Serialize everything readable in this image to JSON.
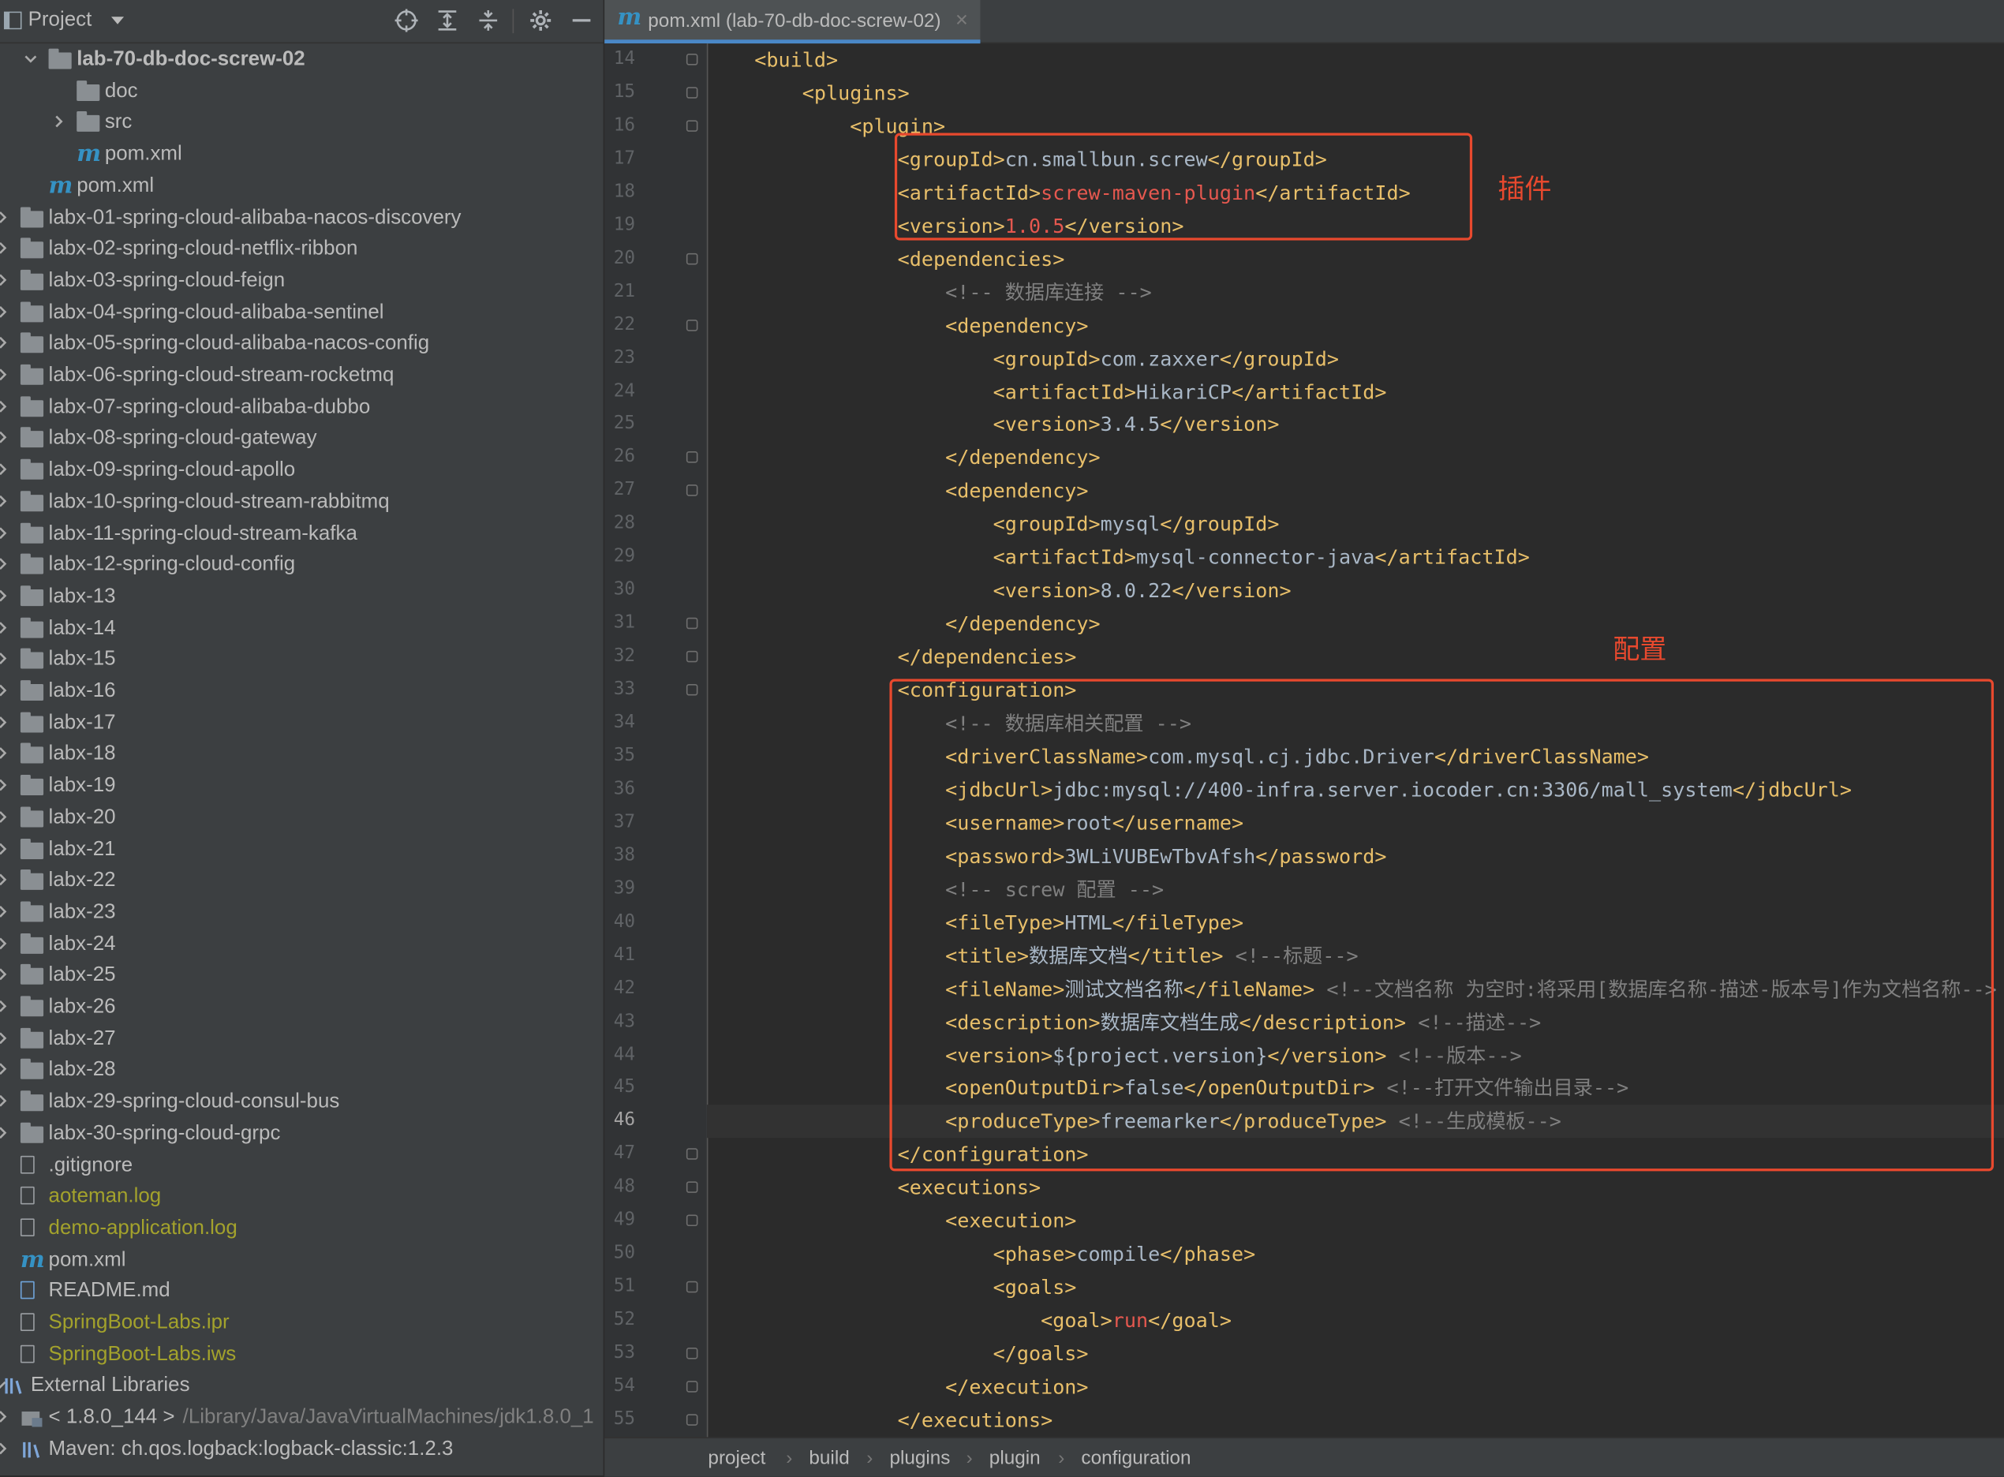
{
  "project_panel": {
    "title": "Project",
    "tree": [
      {
        "label": "lab-70-db-doc-screw-02",
        "kind": "folder",
        "indent": 1,
        "arrow": "down",
        "bold": true
      },
      {
        "label": "doc",
        "kind": "folder",
        "indent": 2,
        "arrow": ""
      },
      {
        "label": "src",
        "kind": "folder",
        "indent": 2,
        "arrow": "right"
      },
      {
        "label": "pom.xml",
        "kind": "maven",
        "indent": 2,
        "arrow": ""
      },
      {
        "label": "pom.xml",
        "kind": "maven",
        "indent": 1,
        "arrow": ""
      },
      {
        "label": "labx-01-spring-cloud-alibaba-nacos-discovery",
        "kind": "folder",
        "indent": 0,
        "arrow": "right"
      },
      {
        "label": "labx-02-spring-cloud-netflix-ribbon",
        "kind": "folder",
        "indent": 0,
        "arrow": "right"
      },
      {
        "label": "labx-03-spring-cloud-feign",
        "kind": "folder",
        "indent": 0,
        "arrow": "right"
      },
      {
        "label": "labx-04-spring-cloud-alibaba-sentinel",
        "kind": "folder",
        "indent": 0,
        "arrow": "right"
      },
      {
        "label": "labx-05-spring-cloud-alibaba-nacos-config",
        "kind": "folder",
        "indent": 0,
        "arrow": "right"
      },
      {
        "label": "labx-06-spring-cloud-stream-rocketmq",
        "kind": "folder",
        "indent": 0,
        "arrow": "right"
      },
      {
        "label": "labx-07-spring-cloud-alibaba-dubbo",
        "kind": "folder",
        "indent": 0,
        "arrow": "right"
      },
      {
        "label": "labx-08-spring-cloud-gateway",
        "kind": "folder",
        "indent": 0,
        "arrow": "right"
      },
      {
        "label": "labx-09-spring-cloud-apollo",
        "kind": "folder",
        "indent": 0,
        "arrow": "right"
      },
      {
        "label": "labx-10-spring-cloud-stream-rabbitmq",
        "kind": "folder",
        "indent": 0,
        "arrow": "right"
      },
      {
        "label": "labx-11-spring-cloud-stream-kafka",
        "kind": "folder",
        "indent": 0,
        "arrow": "right"
      },
      {
        "label": "labx-12-spring-cloud-config",
        "kind": "folder",
        "indent": 0,
        "arrow": "right"
      },
      {
        "label": "labx-13",
        "kind": "folder",
        "indent": 0,
        "arrow": "right"
      },
      {
        "label": "labx-14",
        "kind": "folder",
        "indent": 0,
        "arrow": "right"
      },
      {
        "label": "labx-15",
        "kind": "folder",
        "indent": 0,
        "arrow": "right"
      },
      {
        "label": "labx-16",
        "kind": "folder",
        "indent": 0,
        "arrow": "right"
      },
      {
        "label": "labx-17",
        "kind": "folder",
        "indent": 0,
        "arrow": "right"
      },
      {
        "label": "labx-18",
        "kind": "folder",
        "indent": 0,
        "arrow": "right"
      },
      {
        "label": "labx-19",
        "kind": "folder",
        "indent": 0,
        "arrow": "right"
      },
      {
        "label": "labx-20",
        "kind": "folder",
        "indent": 0,
        "arrow": "right"
      },
      {
        "label": "labx-21",
        "kind": "folder",
        "indent": 0,
        "arrow": "right"
      },
      {
        "label": "labx-22",
        "kind": "folder",
        "indent": 0,
        "arrow": "right"
      },
      {
        "label": "labx-23",
        "kind": "folder",
        "indent": 0,
        "arrow": "right"
      },
      {
        "label": "labx-24",
        "kind": "folder",
        "indent": 0,
        "arrow": "right"
      },
      {
        "label": "labx-25",
        "kind": "folder",
        "indent": 0,
        "arrow": "right"
      },
      {
        "label": "labx-26",
        "kind": "folder",
        "indent": 0,
        "arrow": "right"
      },
      {
        "label": "labx-27",
        "kind": "folder",
        "indent": 0,
        "arrow": "right"
      },
      {
        "label": "labx-28",
        "kind": "folder",
        "indent": 0,
        "arrow": "right"
      },
      {
        "label": "labx-29-spring-cloud-consul-bus",
        "kind": "folder",
        "indent": 0,
        "arrow": "right"
      },
      {
        "label": "labx-30-spring-cloud-grpc",
        "kind": "folder",
        "indent": 0,
        "arrow": "right"
      },
      {
        "label": ".gitignore",
        "kind": "file",
        "indent": 0,
        "arrow": ""
      },
      {
        "label": "aoteman.log",
        "kind": "file",
        "indent": 0,
        "arrow": "",
        "yellow": true
      },
      {
        "label": "demo-application.log",
        "kind": "file",
        "indent": 0,
        "arrow": "",
        "yellow": true
      },
      {
        "label": "pom.xml",
        "kind": "maven",
        "indent": 0,
        "arrow": ""
      },
      {
        "label": "README.md",
        "kind": "md",
        "indent": 0,
        "arrow": ""
      },
      {
        "label": "SpringBoot-Labs.ipr",
        "kind": "file",
        "indent": 0,
        "arrow": "",
        "yellow": true
      },
      {
        "label": "SpringBoot-Labs.iws",
        "kind": "file",
        "indent": 0,
        "arrow": "",
        "yellow": true
      },
      {
        "label": "External Libraries",
        "kind": "lib",
        "indent": -1,
        "arrow": "down"
      },
      {
        "label": "< 1.8.0_144 >",
        "path": "/Library/Java/JavaVirtualMachines/jdk1.8.0_1",
        "kind": "jdk",
        "indent": 0,
        "arrow": "right"
      },
      {
        "label": "Maven: ch.qos.logback:logback-classic:1.2.3",
        "kind": "lib",
        "indent": 0,
        "arrow": "right"
      }
    ]
  },
  "editor": {
    "tab_title": "pom.xml (lab-70-db-doc-screw-02)",
    "current_line": 46,
    "lines": [
      {
        "n": 14,
        "fold": true,
        "parts": [
          [
            "i",
            "    "
          ],
          [
            "t",
            "<build>"
          ]
        ]
      },
      {
        "n": 15,
        "fold": true,
        "parts": [
          [
            "i",
            "        "
          ],
          [
            "t",
            "<plugins>"
          ]
        ]
      },
      {
        "n": 16,
        "fold": true,
        "parts": [
          [
            "i",
            "            "
          ],
          [
            "t",
            "<plugin>"
          ]
        ]
      },
      {
        "n": 17,
        "parts": [
          [
            "i",
            "                "
          ],
          [
            "t",
            "<groupId>"
          ],
          [
            "x",
            "cn.smallbun.screw"
          ],
          [
            "t",
            "</groupId>"
          ]
        ]
      },
      {
        "n": 18,
        "parts": [
          [
            "i",
            "                "
          ],
          [
            "t",
            "<artifactId>"
          ],
          [
            "r",
            "screw-maven-plugin"
          ],
          [
            "t",
            "</artifactId>"
          ]
        ]
      },
      {
        "n": 19,
        "parts": [
          [
            "i",
            "                "
          ],
          [
            "t",
            "<version>"
          ],
          [
            "r",
            "1.0.5"
          ],
          [
            "t",
            "</version>"
          ]
        ]
      },
      {
        "n": 20,
        "fold": true,
        "parts": [
          [
            "i",
            "                "
          ],
          [
            "t",
            "<dependencies>"
          ]
        ]
      },
      {
        "n": 21,
        "parts": [
          [
            "i",
            "                    "
          ],
          [
            "c",
            "<!-- 数据库连接 -->"
          ]
        ]
      },
      {
        "n": 22,
        "fold": true,
        "parts": [
          [
            "i",
            "                    "
          ],
          [
            "t",
            "<dependency>"
          ]
        ]
      },
      {
        "n": 23,
        "parts": [
          [
            "i",
            "                        "
          ],
          [
            "t",
            "<groupId>"
          ],
          [
            "x",
            "com.zaxxer"
          ],
          [
            "t",
            "</groupId>"
          ]
        ]
      },
      {
        "n": 24,
        "parts": [
          [
            "i",
            "                        "
          ],
          [
            "t",
            "<artifactId>"
          ],
          [
            "x",
            "HikariCP"
          ],
          [
            "t",
            "</artifactId>"
          ]
        ]
      },
      {
        "n": 25,
        "parts": [
          [
            "i",
            "                        "
          ],
          [
            "t",
            "<version>"
          ],
          [
            "x",
            "3.4.5"
          ],
          [
            "t",
            "</version>"
          ]
        ]
      },
      {
        "n": 26,
        "fold": true,
        "parts": [
          [
            "i",
            "                    "
          ],
          [
            "t",
            "</dependency>"
          ]
        ]
      },
      {
        "n": 27,
        "fold": true,
        "parts": [
          [
            "i",
            "                    "
          ],
          [
            "t",
            "<dependency>"
          ]
        ]
      },
      {
        "n": 28,
        "parts": [
          [
            "i",
            "                        "
          ],
          [
            "t",
            "<groupId>"
          ],
          [
            "x",
            "mysql"
          ],
          [
            "t",
            "</groupId>"
          ]
        ]
      },
      {
        "n": 29,
        "parts": [
          [
            "i",
            "                        "
          ],
          [
            "t",
            "<artifactId>"
          ],
          [
            "x",
            "mysql-connector-java"
          ],
          [
            "t",
            "</artifactId>"
          ]
        ]
      },
      {
        "n": 30,
        "parts": [
          [
            "i",
            "                        "
          ],
          [
            "t",
            "<version>"
          ],
          [
            "x",
            "8.0.22"
          ],
          [
            "t",
            "</version>"
          ]
        ]
      },
      {
        "n": 31,
        "fold": true,
        "parts": [
          [
            "i",
            "                    "
          ],
          [
            "t",
            "</dependency>"
          ]
        ]
      },
      {
        "n": 32,
        "fold": true,
        "parts": [
          [
            "i",
            "                "
          ],
          [
            "t",
            "</dependencies>"
          ]
        ]
      },
      {
        "n": 33,
        "fold": true,
        "parts": [
          [
            "i",
            "                "
          ],
          [
            "t",
            "<configuration>"
          ]
        ]
      },
      {
        "n": 34,
        "parts": [
          [
            "i",
            "                    "
          ],
          [
            "c",
            "<!-- 数据库相关配置 -->"
          ]
        ]
      },
      {
        "n": 35,
        "parts": [
          [
            "i",
            "                    "
          ],
          [
            "t",
            "<driverClassName>"
          ],
          [
            "x",
            "com.mysql.cj.jdbc.Driver"
          ],
          [
            "t",
            "</driverClassName>"
          ]
        ]
      },
      {
        "n": 36,
        "parts": [
          [
            "i",
            "                    "
          ],
          [
            "t",
            "<jdbcUrl>"
          ],
          [
            "x",
            "jdbc:mysql://400-infra.server.iocoder.cn:3306/mall_system"
          ],
          [
            "t",
            "</jdbcUrl>"
          ]
        ]
      },
      {
        "n": 37,
        "parts": [
          [
            "i",
            "                    "
          ],
          [
            "t",
            "<username>"
          ],
          [
            "x",
            "root"
          ],
          [
            "t",
            "</username>"
          ]
        ]
      },
      {
        "n": 38,
        "parts": [
          [
            "i",
            "                    "
          ],
          [
            "t",
            "<password>"
          ],
          [
            "x",
            "3WLiVUBEwTbvAfsh"
          ],
          [
            "t",
            "</password>"
          ]
        ]
      },
      {
        "n": 39,
        "parts": [
          [
            "i",
            "                    "
          ],
          [
            "c",
            "<!-- screw 配置 -->"
          ]
        ]
      },
      {
        "n": 40,
        "parts": [
          [
            "i",
            "                    "
          ],
          [
            "t",
            "<fileType>"
          ],
          [
            "x",
            "HTML"
          ],
          [
            "t",
            "</fileType>"
          ]
        ]
      },
      {
        "n": 41,
        "parts": [
          [
            "i",
            "                    "
          ],
          [
            "t",
            "<title>"
          ],
          [
            "x",
            "数据库文档"
          ],
          [
            "t",
            "</title>"
          ],
          [
            "x",
            " "
          ],
          [
            "c",
            "<!--标题-->"
          ]
        ]
      },
      {
        "n": 42,
        "parts": [
          [
            "i",
            "                    "
          ],
          [
            "t",
            "<fileName>"
          ],
          [
            "x",
            "测试文档名称"
          ],
          [
            "t",
            "</fileName>"
          ],
          [
            "x",
            " "
          ],
          [
            "c",
            "<!--文档名称 为空时:将采用[数据库名称-描述-版本号]作为文档名称-->"
          ]
        ]
      },
      {
        "n": 43,
        "parts": [
          [
            "i",
            "                    "
          ],
          [
            "t",
            "<description>"
          ],
          [
            "x",
            "数据库文档生成"
          ],
          [
            "t",
            "</description>"
          ],
          [
            "x",
            " "
          ],
          [
            "c",
            "<!--描述-->"
          ]
        ]
      },
      {
        "n": 44,
        "parts": [
          [
            "i",
            "                    "
          ],
          [
            "t",
            "<version>"
          ],
          [
            "x",
            "${project.version}"
          ],
          [
            "t",
            "</version>"
          ],
          [
            "x",
            " "
          ],
          [
            "c",
            "<!--版本-->"
          ]
        ]
      },
      {
        "n": 45,
        "parts": [
          [
            "i",
            "                    "
          ],
          [
            "t",
            "<openOutputDir>"
          ],
          [
            "x",
            "false"
          ],
          [
            "t",
            "</openOutputDir>"
          ],
          [
            "x",
            " "
          ],
          [
            "c",
            "<!--打开文件输出目录-->"
          ]
        ]
      },
      {
        "n": 46,
        "parts": [
          [
            "i",
            "                    "
          ],
          [
            "t",
            "<produceType>"
          ],
          [
            "x",
            "freemarker"
          ],
          [
            "t",
            "</produceType>"
          ],
          [
            "x",
            " "
          ],
          [
            "c",
            "<!--生成模板-->"
          ]
        ]
      },
      {
        "n": 47,
        "fold": true,
        "parts": [
          [
            "i",
            "                "
          ],
          [
            "t",
            "</configuration>"
          ]
        ]
      },
      {
        "n": 48,
        "fold": true,
        "parts": [
          [
            "i",
            "                "
          ],
          [
            "t",
            "<executions>"
          ]
        ]
      },
      {
        "n": 49,
        "fold": true,
        "parts": [
          [
            "i",
            "                    "
          ],
          [
            "t",
            "<execution>"
          ]
        ]
      },
      {
        "n": 50,
        "parts": [
          [
            "i",
            "                        "
          ],
          [
            "t",
            "<phase>"
          ],
          [
            "x",
            "compile"
          ],
          [
            "t",
            "</phase>"
          ]
        ]
      },
      {
        "n": 51,
        "fold": true,
        "parts": [
          [
            "i",
            "                        "
          ],
          [
            "t",
            "<goals>"
          ]
        ]
      },
      {
        "n": 52,
        "parts": [
          [
            "i",
            "                            "
          ],
          [
            "t",
            "<goal>"
          ],
          [
            "r",
            "run"
          ],
          [
            "t",
            "</goal>"
          ]
        ]
      },
      {
        "n": 53,
        "fold": true,
        "parts": [
          [
            "i",
            "                        "
          ],
          [
            "t",
            "</goals>"
          ]
        ]
      },
      {
        "n": 54,
        "fold": true,
        "parts": [
          [
            "i",
            "                    "
          ],
          [
            "t",
            "</execution>"
          ]
        ]
      },
      {
        "n": 55,
        "fold": true,
        "parts": [
          [
            "i",
            "                "
          ],
          [
            "t",
            "</executions>"
          ]
        ]
      }
    ]
  },
  "breadcrumb": [
    "project",
    "build",
    "plugins",
    "plugin",
    "configuration"
  ],
  "annotations": {
    "plugin_label": "插件",
    "config_label": "配置",
    "color": "#e8492e"
  }
}
